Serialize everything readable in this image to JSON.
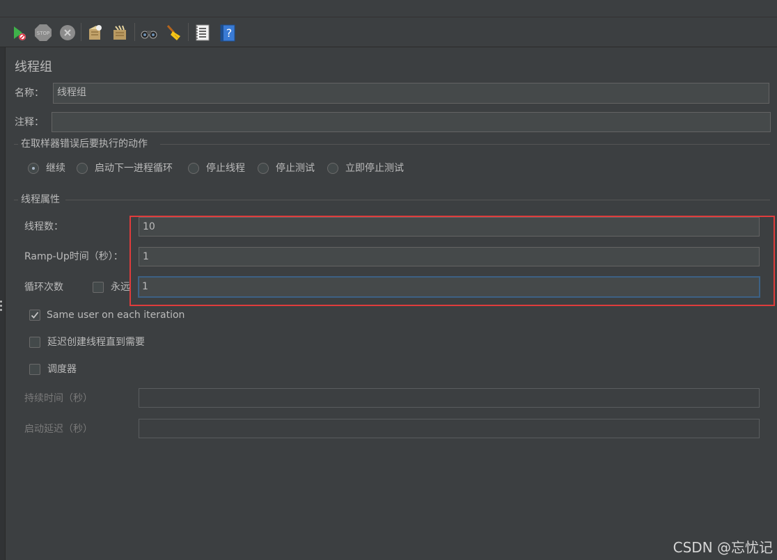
{
  "toolbar": {
    "icons": [
      "start-no-pauses-icon",
      "stop-icon",
      "shutdown-icon",
      "clear-icon",
      "clear-all-icon",
      "search-icon",
      "reset-search-icon",
      "function-helper-icon",
      "help-icon"
    ]
  },
  "panel": {
    "title": "线程组",
    "name_label": "名称：",
    "name_value": "线程组",
    "comment_label": "注释：",
    "comment_value": ""
  },
  "sampler_error": {
    "legend": "在取样器错误后要执行的动作",
    "options": [
      "继续",
      "启动下一进程循环",
      "停止线程",
      "停止测试",
      "立即停止测试"
    ],
    "selected": "继续"
  },
  "thread_props": {
    "legend": "线程属性",
    "threads_label": "线程数：",
    "threads_value": "10",
    "rampup_label": "Ramp-Up时间（秒）：",
    "rampup_value": "1",
    "loop_label": "循环次数",
    "forever_label": "永远",
    "forever_checked": false,
    "loop_value": "1",
    "same_user_label": "Same user on each iteration",
    "same_user_checked": true,
    "delay_label": "延迟创建线程直到需要",
    "delay_checked": false,
    "scheduler_label": "调度器",
    "scheduler_checked": false,
    "duration_label": "持续时间（秒）",
    "duration_value": "",
    "startup_delay_label": "启动延迟（秒）",
    "startup_delay_value": ""
  },
  "highlight_color": "#e03c3c",
  "watermark": "CSDN @忘忧记"
}
